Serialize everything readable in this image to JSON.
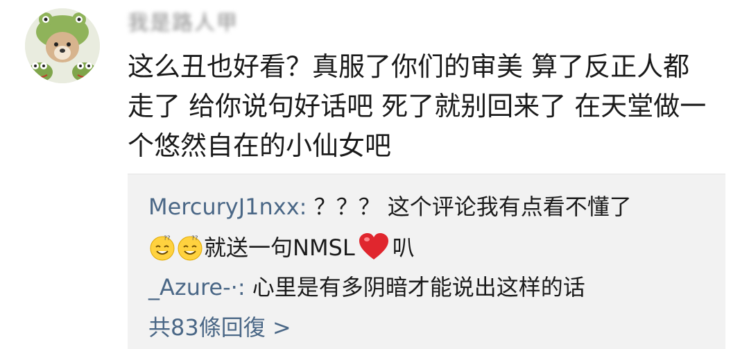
{
  "comment": {
    "username": "我是路人甲",
    "avatar_icon": "frog-hat-dog-avatar",
    "text_lines": [
      "这么丑也好看？真服了你们的审美 算了反正人都",
      "走了 给你说句好话吧 死了就别回来了 在天堂做一",
      "个悠然自在的小仙女吧"
    ]
  },
  "replies": [
    {
      "username": "MercuryJ1nxx:",
      "text": " ？？？ 这个评论我有点看不懂了",
      "continuation_after_emoji": "就送一句NMSL",
      "continuation_end": "叭",
      "emojis": [
        "sweat-smile-icon",
        "sweat-smile-icon"
      ],
      "inline_icon": "red-heart-icon"
    },
    {
      "username": "_Azure-·:",
      "text": " 心里是有多阴暗才能说出这样的话"
    }
  ],
  "more_replies": {
    "label": "共83條回復 >"
  },
  "colors": {
    "link": "#4a6786",
    "reply_bg": "#f2f2f2",
    "text": "#1a1a1a",
    "heart": "#e0262e"
  }
}
